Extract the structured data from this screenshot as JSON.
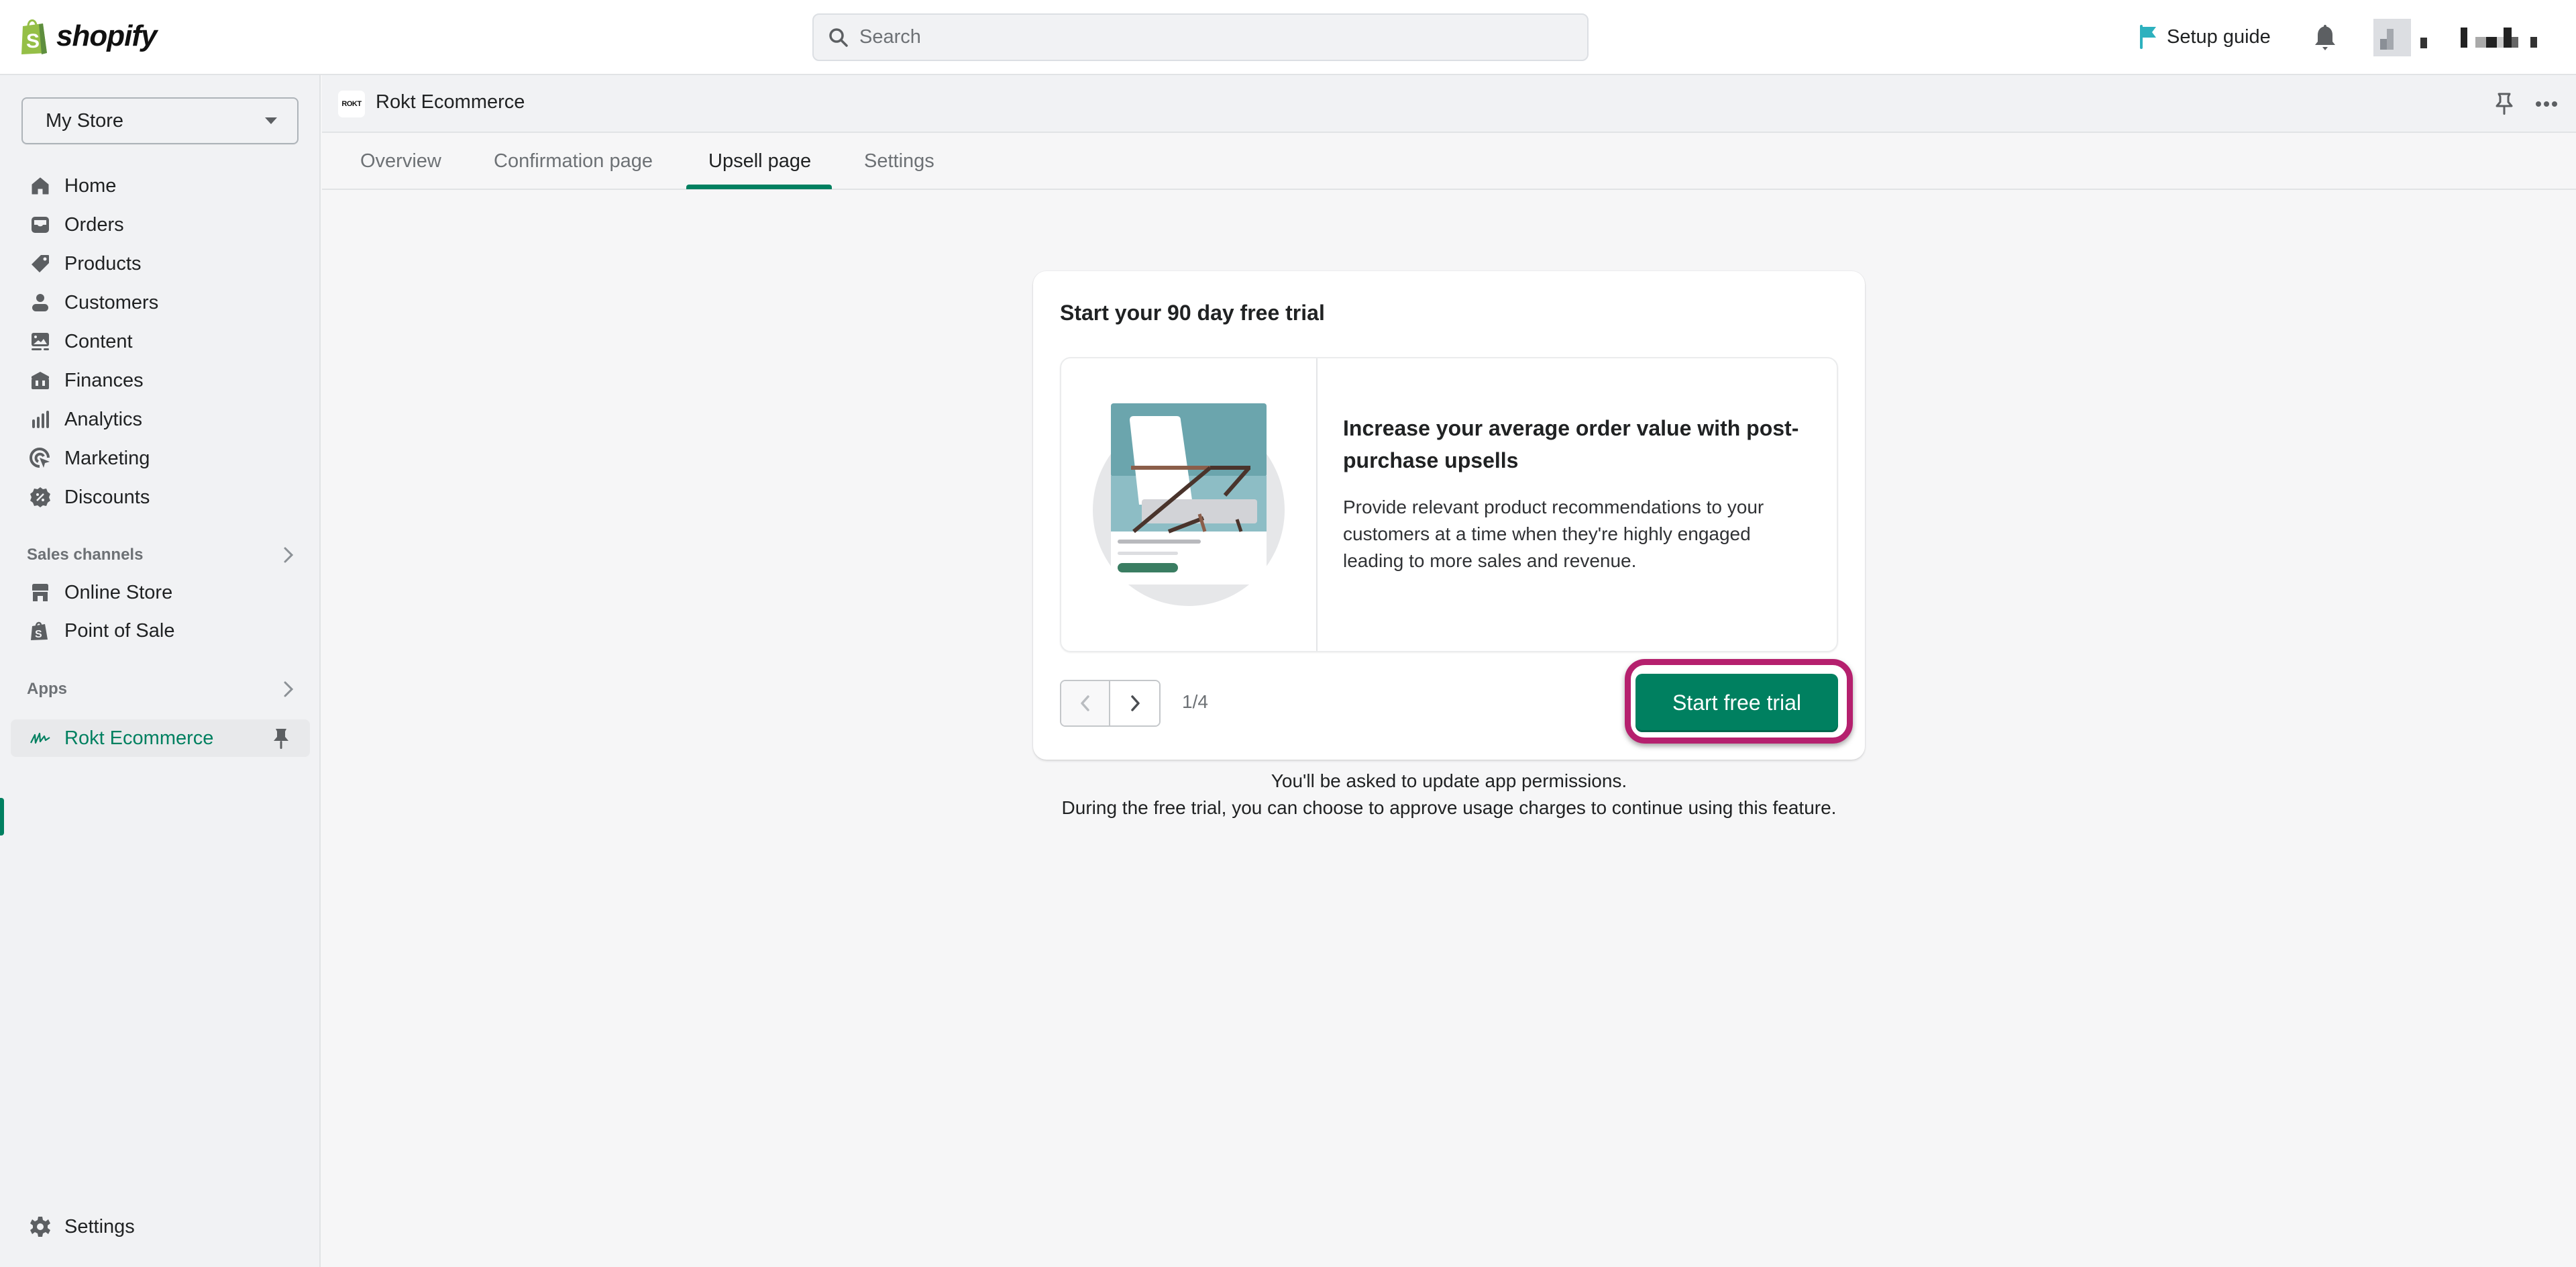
{
  "topbar": {
    "brand": "shopify",
    "search_placeholder": "Search",
    "setup_guide_label": "Setup guide",
    "icons": {
      "logo": "shopify-bag-icon",
      "search": "search-icon",
      "setup": "flag-icon",
      "notifications": "bell-icon",
      "account": "avatar-redacted"
    }
  },
  "sidebar": {
    "store_selector": "My Store",
    "items": [
      {
        "label": "Home",
        "icon": "home-icon"
      },
      {
        "label": "Orders",
        "icon": "inbox-icon"
      },
      {
        "label": "Products",
        "icon": "tag-icon"
      },
      {
        "label": "Customers",
        "icon": "person-icon"
      },
      {
        "label": "Content",
        "icon": "image-icon"
      },
      {
        "label": "Finances",
        "icon": "bank-icon"
      },
      {
        "label": "Analytics",
        "icon": "bar-chart-icon"
      },
      {
        "label": "Marketing",
        "icon": "target-icon"
      },
      {
        "label": "Discounts",
        "icon": "discount-icon"
      }
    ],
    "sales_channels": {
      "heading": "Sales channels",
      "items": [
        {
          "label": "Online Store",
          "icon": "store-icon"
        },
        {
          "label": "Point of Sale",
          "icon": "pos-bag-icon"
        }
      ]
    },
    "apps": {
      "heading": "Apps",
      "items": [
        {
          "label": "Rokt Ecommerce",
          "icon": "rokt-icon",
          "active": true,
          "pinned": true
        }
      ]
    },
    "settings_label": "Settings"
  },
  "app": {
    "logo_text": "ROKT",
    "title": "Rokt Ecommerce",
    "tabs": [
      {
        "label": "Overview",
        "active": false
      },
      {
        "label": "Confirmation page",
        "active": false
      },
      {
        "label": "Upsell page",
        "active": true
      },
      {
        "label": "Settings",
        "active": false
      }
    ]
  },
  "trial_card": {
    "title": "Start your 90 day free trial",
    "slide": {
      "heading": "Increase your average order value with post-purchase upsells",
      "body": "Provide relevant product recommendations to your customers at a time when they're highly engaged leading to more sales and revenue."
    },
    "pagination": {
      "current": 1,
      "total": 4,
      "label": "1/4"
    },
    "cta_label": "Start free trial"
  },
  "footnotes": [
    "You'll be asked to update app permissions.",
    "During the free trial, you can choose to approve usage charges to continue using this feature."
  ],
  "colors": {
    "accent": "#008060",
    "highlight_ring": "#B5206E",
    "setup_flag": "#2DB1BE",
    "illustration_teal": "#6BA5AD"
  }
}
